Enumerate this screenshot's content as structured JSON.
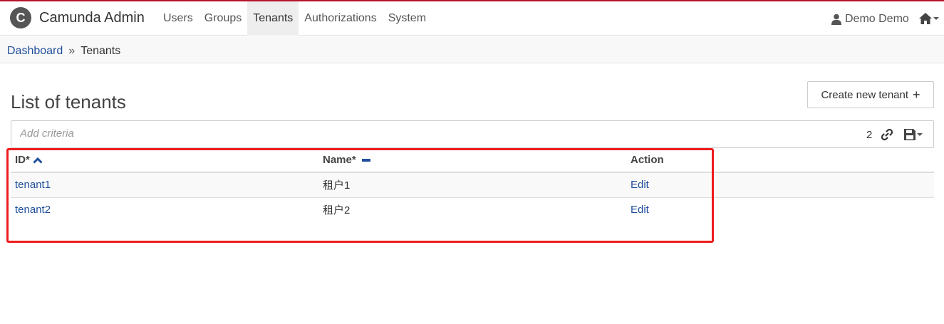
{
  "app": {
    "logo_letter": "C",
    "title": "Camunda Admin"
  },
  "nav": {
    "items": [
      {
        "label": "Users"
      },
      {
        "label": "Groups"
      },
      {
        "label": "Tenants",
        "active": true
      },
      {
        "label": "Authorizations"
      },
      {
        "label": "System"
      }
    ]
  },
  "user": {
    "name": "Demo Demo",
    "icon": "user-icon"
  },
  "home": {
    "icon": "home-icon"
  },
  "breadcrumb": {
    "items": [
      "Dashboard",
      "Tenants"
    ],
    "separator": "»"
  },
  "page": {
    "title": "List of tenants",
    "create_button": "Create new tenant",
    "create_button_icon": "+"
  },
  "search": {
    "placeholder": "Add criteria",
    "count": "2"
  },
  "table": {
    "columns": [
      {
        "label": "ID*",
        "sort": "ascending"
      },
      {
        "label": "Name*",
        "sort": "none"
      },
      {
        "label": "Action"
      }
    ],
    "rows": [
      {
        "id": "tenant1",
        "name": "租户1",
        "action": "Edit"
      },
      {
        "id": "tenant2",
        "name": "租户2",
        "action": "Edit"
      }
    ]
  },
  "colors": {
    "accent": "#b5152b",
    "link": "#1f4e9c",
    "highlight_box": "#ee1c1c"
  }
}
